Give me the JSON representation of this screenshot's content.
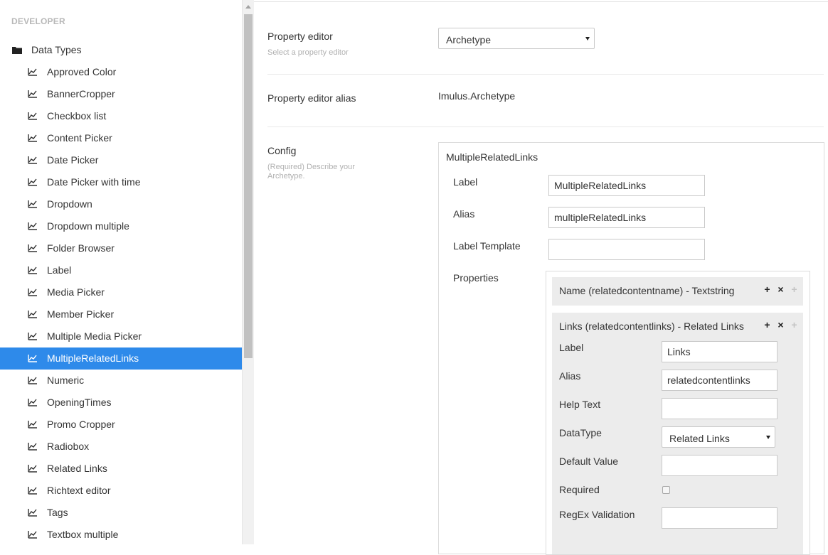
{
  "sidebar": {
    "section_label": "DEVELOPER",
    "root": {
      "icon": "folder-icon",
      "label": "Data Types"
    },
    "items": [
      {
        "label": "Approved Color",
        "icon": "datatype-icon"
      },
      {
        "label": "BannerCropper",
        "icon": "datatype-icon"
      },
      {
        "label": "Checkbox list",
        "icon": "datatype-icon"
      },
      {
        "label": "Content Picker",
        "icon": "datatype-icon"
      },
      {
        "label": "Date Picker",
        "icon": "datatype-icon"
      },
      {
        "label": "Date Picker with time",
        "icon": "datatype-icon"
      },
      {
        "label": "Dropdown",
        "icon": "datatype-icon"
      },
      {
        "label": "Dropdown multiple",
        "icon": "datatype-icon"
      },
      {
        "label": "Folder Browser",
        "icon": "datatype-icon"
      },
      {
        "label": "Label",
        "icon": "datatype-icon"
      },
      {
        "label": "Media Picker",
        "icon": "datatype-icon"
      },
      {
        "label": "Member Picker",
        "icon": "datatype-icon"
      },
      {
        "label": "Multiple Media Picker",
        "icon": "datatype-icon"
      },
      {
        "label": "MultipleRelatedLinks",
        "icon": "datatype-icon",
        "active": true
      },
      {
        "label": "Numeric",
        "icon": "datatype-icon"
      },
      {
        "label": "OpeningTimes",
        "icon": "datatype-icon"
      },
      {
        "label": "Promo Cropper",
        "icon": "datatype-icon"
      },
      {
        "label": "Radiobox",
        "icon": "datatype-icon"
      },
      {
        "label": "Related Links",
        "icon": "datatype-icon"
      },
      {
        "label": "Richtext editor",
        "icon": "datatype-icon"
      },
      {
        "label": "Tags",
        "icon": "datatype-icon"
      },
      {
        "label": "Textbox multiple",
        "icon": "datatype-icon"
      }
    ],
    "active_color": "#2e8aea"
  },
  "main": {
    "property_editor": {
      "label": "Property editor",
      "description": "Select a property editor",
      "selected": "Archetype"
    },
    "property_editor_alias": {
      "label": "Property editor alias",
      "value": "Imulus.Archetype"
    },
    "config": {
      "label": "Config",
      "description": "(Required) Describe your Archetype.",
      "fieldset_title": "MultipleRelatedLinks",
      "fields": {
        "label": {
          "label": "Label",
          "value": "MultipleRelatedLinks"
        },
        "alias": {
          "label": "Alias",
          "value": "multipleRelatedLinks"
        },
        "label_template": {
          "label": "Label Template",
          "value": ""
        }
      },
      "properties_label": "Properties",
      "properties": [
        {
          "title": "Name (relatedcontentname) - Textstring"
        },
        {
          "title": "Links (relatedcontentlinks) - Related Links",
          "fields": {
            "label": {
              "label": "Label",
              "value": "Links"
            },
            "alias": {
              "label": "Alias",
              "value": "relatedcontentlinks"
            },
            "help_text": {
              "label": "Help Text",
              "value": ""
            },
            "datatype": {
              "label": "DataType",
              "value": "Related Links"
            },
            "default_value": {
              "label": "Default Value",
              "value": ""
            },
            "required": {
              "label": "Required",
              "checked": false
            },
            "regex": {
              "label": "RegEx Validation",
              "value": ""
            }
          }
        }
      ],
      "actions": {
        "add": "+",
        "remove": "×",
        "move": "+"
      }
    }
  }
}
